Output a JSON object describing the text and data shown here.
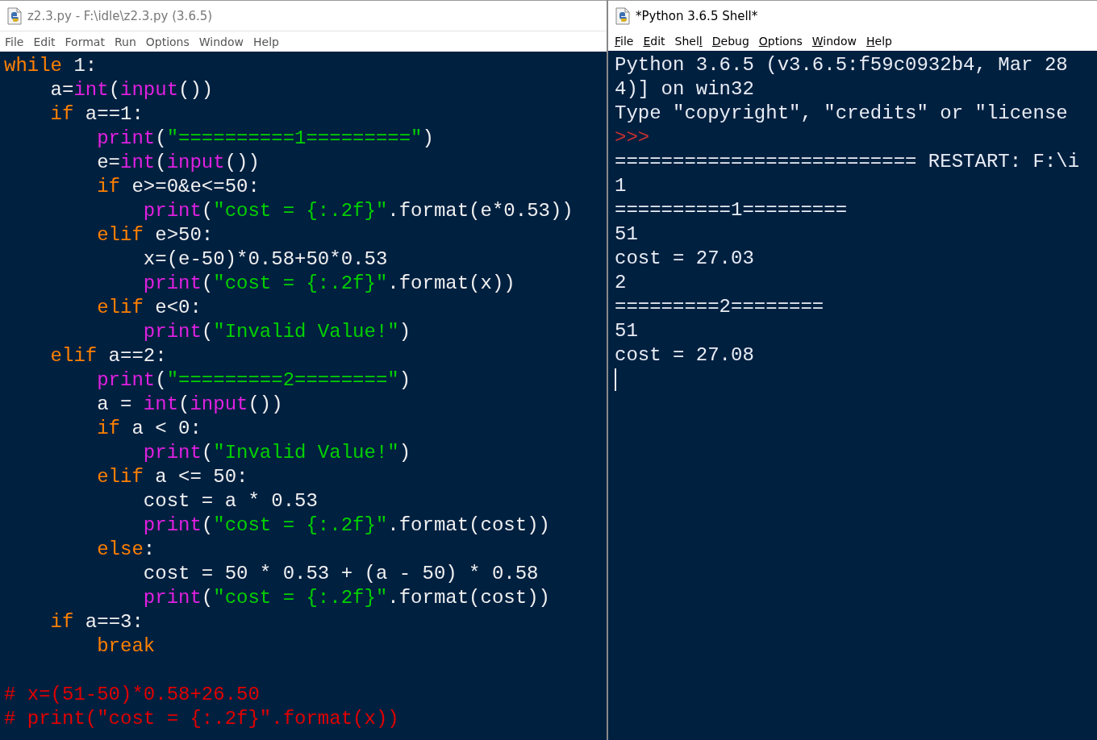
{
  "windows": [
    {
      "kind": "editor",
      "active": false,
      "title": "z2.3.py - F:\\idle\\z2.3.py (3.6.5)",
      "menu": [
        {
          "before": "File"
        },
        {
          "before": "Edit"
        },
        {
          "before": "Format"
        },
        {
          "before": "Run"
        },
        {
          "before": "Options"
        },
        {
          "before": "Window"
        },
        {
          "before": "Help"
        }
      ],
      "lines": [
        [
          {
            "kind": "keyword",
            "text": "while"
          },
          {
            "kind": "plain",
            "text": " 1:"
          }
        ],
        [
          {
            "kind": "plain",
            "text": "    a="
          },
          {
            "kind": "builtin",
            "text": "int"
          },
          {
            "kind": "plain",
            "text": "("
          },
          {
            "kind": "builtin",
            "text": "input"
          },
          {
            "kind": "plain",
            "text": "())"
          }
        ],
        [
          {
            "kind": "keyword",
            "text": "    if"
          },
          {
            "kind": "plain",
            "text": " a==1:"
          }
        ],
        [
          {
            "kind": "builtin",
            "text": "        print"
          },
          {
            "kind": "plain",
            "text": "("
          },
          {
            "kind": "string",
            "text": "\"==========1=========\""
          },
          {
            "kind": "plain",
            "text": ")"
          }
        ],
        [
          {
            "kind": "plain",
            "text": "        e="
          },
          {
            "kind": "builtin",
            "text": "int"
          },
          {
            "kind": "plain",
            "text": "("
          },
          {
            "kind": "builtin",
            "text": "input"
          },
          {
            "kind": "plain",
            "text": "())"
          }
        ],
        [
          {
            "kind": "keyword",
            "text": "        if"
          },
          {
            "kind": "plain",
            "text": " e>=0&e<=50:"
          }
        ],
        [
          {
            "kind": "builtin",
            "text": "            print"
          },
          {
            "kind": "plain",
            "text": "("
          },
          {
            "kind": "string",
            "text": "\"cost = {:.2f}\""
          },
          {
            "kind": "plain",
            "text": ".format(e*0.53))"
          }
        ],
        [
          {
            "kind": "keyword",
            "text": "        elif"
          },
          {
            "kind": "plain",
            "text": " e>50:"
          }
        ],
        [
          {
            "kind": "plain",
            "text": "            x=(e-50)*0.58+50*0.53"
          }
        ],
        [
          {
            "kind": "builtin",
            "text": "            print"
          },
          {
            "kind": "plain",
            "text": "("
          },
          {
            "kind": "string",
            "text": "\"cost = {:.2f}\""
          },
          {
            "kind": "plain",
            "text": ".format(x))"
          }
        ],
        [
          {
            "kind": "keyword",
            "text": "        elif"
          },
          {
            "kind": "plain",
            "text": " e<0:"
          }
        ],
        [
          {
            "kind": "builtin",
            "text": "            print"
          },
          {
            "kind": "plain",
            "text": "("
          },
          {
            "kind": "string",
            "text": "\"Invalid Value!\""
          },
          {
            "kind": "plain",
            "text": ")"
          }
        ],
        [
          {
            "kind": "keyword",
            "text": "    elif"
          },
          {
            "kind": "plain",
            "text": " a==2:"
          }
        ],
        [
          {
            "kind": "builtin",
            "text": "        print"
          },
          {
            "kind": "plain",
            "text": "("
          },
          {
            "kind": "string",
            "text": "\"=========2========\""
          },
          {
            "kind": "plain",
            "text": ")"
          }
        ],
        [
          {
            "kind": "plain",
            "text": "        a = "
          },
          {
            "kind": "builtin",
            "text": "int"
          },
          {
            "kind": "plain",
            "text": "("
          },
          {
            "kind": "builtin",
            "text": "input"
          },
          {
            "kind": "plain",
            "text": "())"
          }
        ],
        [
          {
            "kind": "keyword",
            "text": "        if"
          },
          {
            "kind": "plain",
            "text": " a < 0:"
          }
        ],
        [
          {
            "kind": "builtin",
            "text": "            print"
          },
          {
            "kind": "plain",
            "text": "("
          },
          {
            "kind": "string",
            "text": "\"Invalid Value!\""
          },
          {
            "kind": "plain",
            "text": ")"
          }
        ],
        [
          {
            "kind": "keyword",
            "text": "        elif"
          },
          {
            "kind": "plain",
            "text": " a <= 50:"
          }
        ],
        [
          {
            "kind": "plain",
            "text": "            cost = a * 0.53"
          }
        ],
        [
          {
            "kind": "builtin",
            "text": "            print"
          },
          {
            "kind": "plain",
            "text": "("
          },
          {
            "kind": "string",
            "text": "\"cost = {:.2f}\""
          },
          {
            "kind": "plain",
            "text": ".format(cost))"
          }
        ],
        [
          {
            "kind": "keyword",
            "text": "        else"
          },
          {
            "kind": "plain",
            "text": ":"
          }
        ],
        [
          {
            "kind": "plain",
            "text": "            cost = 50 * 0.53 + (a - 50) * 0.58"
          }
        ],
        [
          {
            "kind": "builtin",
            "text": "            print"
          },
          {
            "kind": "plain",
            "text": "("
          },
          {
            "kind": "string",
            "text": "\"cost = {:.2f}\""
          },
          {
            "kind": "plain",
            "text": ".format(cost))"
          }
        ],
        [
          {
            "kind": "keyword",
            "text": "    if"
          },
          {
            "kind": "plain",
            "text": " a==3:"
          }
        ],
        [
          {
            "kind": "keyword",
            "text": "        break"
          }
        ]
      ],
      "comment_block": [
        [
          {
            "kind": "comment",
            "text": "# x=(51-50)*0.58+26.50"
          }
        ],
        [
          {
            "kind": "comment",
            "text": "# print(\"cost = {:.2f}\".format(x))"
          }
        ]
      ]
    },
    {
      "kind": "shell",
      "active": true,
      "title": "*Python 3.6.5 Shell*",
      "menu": [
        {
          "key": "F",
          "after": "ile"
        },
        {
          "key": "E",
          "after": "dit"
        },
        {
          "before": "Shel",
          "key": "l"
        },
        {
          "key": "D",
          "after": "ebug"
        },
        {
          "key": "O",
          "after": "ptions"
        },
        {
          "key": "W",
          "after": "indow"
        },
        {
          "key": "H",
          "after": "elp"
        }
      ],
      "lines": [
        {
          "kind": "output",
          "text": "Python 3.6.5 (v3.6.5:f59c0932b4, Mar 28"
        },
        {
          "kind": "output",
          "text": "4)] on win32"
        },
        {
          "kind": "output",
          "text": "Type \"copyright\", \"credits\" or \"license"
        },
        {
          "kind": "prompt",
          "text": ">>>"
        },
        {
          "kind": "output",
          "text": "========================== RESTART: F:\\i"
        },
        {
          "kind": "output",
          "text": "1"
        },
        {
          "kind": "output",
          "text": "==========1========="
        },
        {
          "kind": "output",
          "text": "51"
        },
        {
          "kind": "output",
          "text": "cost = 27.03"
        },
        {
          "kind": "output",
          "text": "2"
        },
        {
          "kind": "output",
          "text": "=========2========"
        },
        {
          "kind": "output",
          "text": "51"
        },
        {
          "kind": "output",
          "text": "cost = 27.08"
        }
      ]
    }
  ]
}
